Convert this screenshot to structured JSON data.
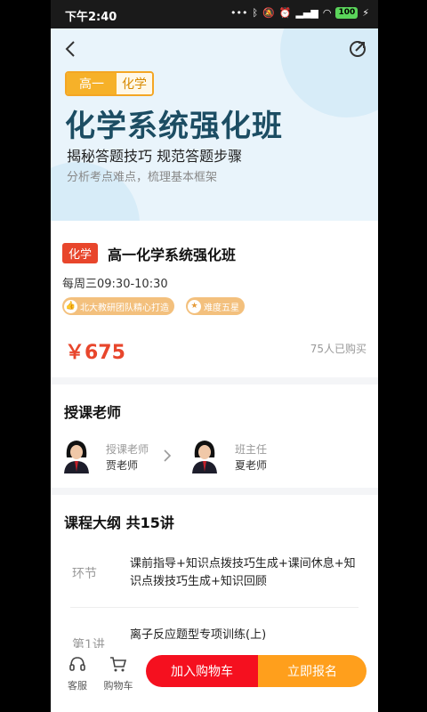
{
  "status_bar": {
    "time": "下午2:40",
    "battery": "100"
  },
  "banner": {
    "grade_tag": "高一",
    "subject_tag": "化学",
    "title": "化学系统强化班",
    "subtitle": "揭秘答题技巧  规范答题步骤",
    "description": "分析考点难点，梳理基本框架"
  },
  "course": {
    "subject_chip": "化学",
    "name": "高一化学系统强化班",
    "schedule": "每周三09:30-10:30",
    "badges": [
      {
        "icon": "thumb-up-icon",
        "label": "北大教研团队精心打造"
      },
      {
        "icon": "star-icon",
        "label": "难度五星"
      }
    ],
    "price": "￥675",
    "purchased": "75人已购买"
  },
  "teachers": {
    "section_title": "授课老师",
    "list": [
      {
        "role": "授课老师",
        "name": "贾老师"
      },
      {
        "role": "班主任",
        "name": "夏老师"
      }
    ]
  },
  "outline": {
    "section_title": "课程大纲 共15讲",
    "items": [
      {
        "label": "环节",
        "text": "课前指导+知识点拨技巧生成+课间休息+知识点拨技巧生成+知识回顾"
      },
      {
        "label": "第1讲",
        "text": "离子反应题型专项训练(上)"
      }
    ]
  },
  "bottom_bar": {
    "service_label": "客服",
    "cart_label": "购物车",
    "add_to_cart": "加入购物车",
    "enroll_now": "立即报名"
  },
  "colors": {
    "accent_red": "#e8462c",
    "cart_button": "#f5101f",
    "enroll_button": "#ff9f1c",
    "banner_bg": "#e9f4fb",
    "title_color": "#1c4d63"
  }
}
